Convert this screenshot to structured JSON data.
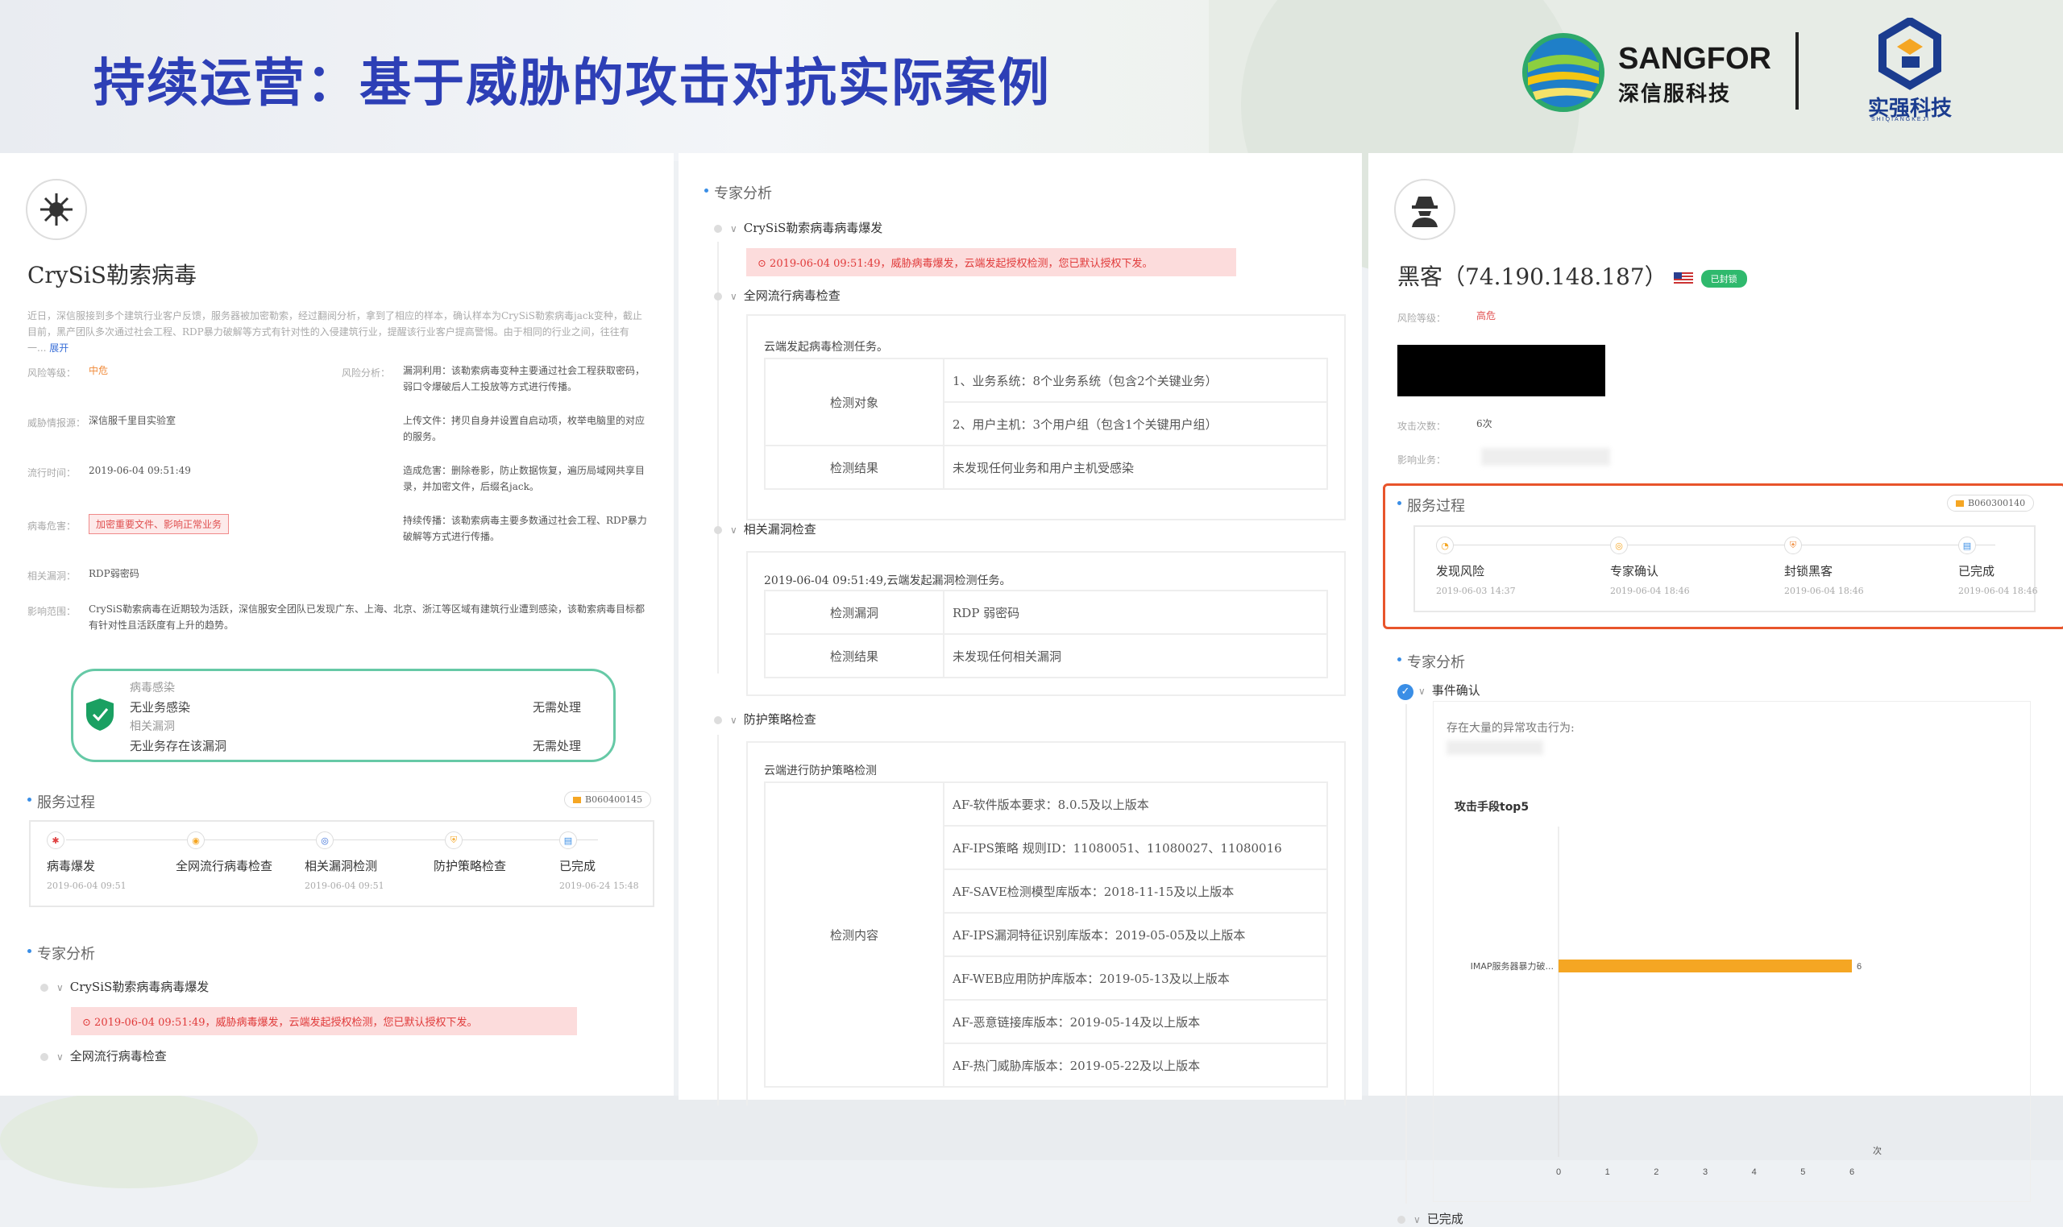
{
  "header": {
    "title": "持续运营：基于威胁的攻击对抗实际案例",
    "brand_en": "SANGFOR",
    "brand_cn": "深信服科技",
    "partner_name": "实强科技",
    "partner_sub": "SHIQIANGKEJI"
  },
  "panel1": {
    "name": "CrySiS勒索病毒",
    "description": "近日，深信服接到多个建筑行业客户反馈，服务器被加密勒索，经过翻阅分析，拿到了相应的样本，确认样本为CrySiS勒索病毒jack变种，截止目前，黑产团队多次通过社会工程、RDP暴力破解等方式有针对性的入侵建筑行业，提醒该行业客户提高警惕。由于相同的行业之间，往往有一...",
    "expand": "展开",
    "fields": [
      {
        "label": "风险等级：",
        "value": "中危"
      },
      {
        "label": "威胁情报源：",
        "value": "深信服千里目实验室"
      },
      {
        "label": "流行时间：",
        "value": "2019-06-04 09:51:49"
      },
      {
        "label": "病毒危害：",
        "value": "加密重要文件、影响正常业务"
      },
      {
        "label": "相关漏洞：",
        "value": "RDP弱密码"
      },
      {
        "label": "影响范围：",
        "value": "CrySiS勒索病毒在近期较为活跃，深信服安全团队已发现广东、上海、北京、浙江等区域有建筑行业遭到感染，该勒索病毒目标都有针对性且活跃度有上升的趋势。"
      }
    ],
    "risk_label": "风险分析：",
    "risk_items": [
      "漏洞利用：该勒索病毒变种主要通过社会工程获取密码，弱口令爆破后人工投放等方式进行传播。",
      "上传文件：拷贝自身并设置自启动项，枚举电脑里的对应的服务。",
      "造成危害：删除卷影，防止数据恢复，遍历局域网共享目录，并加密文件，后缀名jack。",
      "持续传播：该勒索病毒主要多数通过社会工程、RDP暴力破解等方式进行传播。"
    ],
    "status": [
      {
        "title": "病毒感染",
        "text": "无业务感染",
        "action": "无需处理"
      },
      {
        "title": "相关漏洞",
        "text": "无业务存在该漏洞",
        "action": "无需处理"
      }
    ],
    "process_title": "服务过程",
    "process_id": "B060400145",
    "steps": [
      {
        "label": "病毒爆发",
        "date": "2019-06-04 09:51"
      },
      {
        "label": "全网流行病毒检查",
        "date": ""
      },
      {
        "label": "相关漏洞检测",
        "date": "2019-06-04 09:51"
      },
      {
        "label": "防护策略检查",
        "date": ""
      },
      {
        "label": "已完成",
        "date": "2019-06-24 15:48"
      }
    ],
    "expert_title": "专家分析",
    "tree": [
      "CrySiS勒索病毒病毒爆发",
      "全网流行病毒检查"
    ],
    "alert": "2019-06-04 09:51:49，威胁病毒爆发，云端发起授权检测，您已默认授权下发。"
  },
  "panel2": {
    "expert_title": "专家分析",
    "node1": "CrySiS勒索病毒病毒爆发",
    "alert": "2019-06-04 09:51:49，威胁病毒爆发，云端发起授权检测，您已默认授权下发。",
    "node2": "全网流行病毒检查",
    "table1_caption": "云端发起病毒检测任务。",
    "table1": {
      "object_label": "检测对象",
      "objects": [
        "1、业务系统：8个业务系统（包含2个关键业务）",
        "2、用户主机：3个用户组（包含1个关键用户组）"
      ],
      "result_label": "检测结果",
      "result": "未发现任何业务和用户主机受感染"
    },
    "node3": "相关漏洞检查",
    "table2_caption": "2019-06-04 09:51:49,云端发起漏洞检测任务。",
    "table2": {
      "vuln_label": "检测漏洞",
      "vuln": "RDP 弱密码",
      "result_label": "检测结果",
      "result": "未发现任何相关漏洞"
    },
    "node4": "防护策略检查",
    "table3_caption": "云端进行防护策略检测",
    "table3": {
      "content_label": "检测内容",
      "items": [
        "AF-软件版本要求：8.0.5及以上版本",
        "AF-IPS策略 规则ID：11080051、11080027、11080016",
        "AF-SAVE检测模型库版本：2018-11-15及以上版本",
        "AF-IPS漏洞特征识别库版本：2019-05-05及以上版本",
        "AF-WEB应用防护库版本：2019-05-13及以上版本",
        "AF-恶意链接库版本：2019-05-14及以上版本",
        "AF-热门威胁库版本：2019-05-22及以上版本"
      ]
    }
  },
  "panel3": {
    "name": "黑客（74.190.148.187）",
    "badge": "已封锁",
    "risk_label": "风险等级：",
    "risk_value": "高危",
    "attack_count_label": "攻击次数：",
    "attack_count": "6次",
    "impact_label": "影响业务：",
    "process_title": "服务过程",
    "process_id": "B060300140",
    "steps": [
      {
        "label": "发现风险",
        "date": "2019-06-03 14:37"
      },
      {
        "label": "专家确认",
        "date": "2019-06-04 18:46"
      },
      {
        "label": "封锁黑客",
        "date": "2019-06-04 18:46"
      },
      {
        "label": "已完成",
        "date": "2019-06-04 18:46"
      }
    ],
    "expert_title": "专家分析",
    "event_confirm": "事件确认",
    "abnormal_text": "存在大量的异常攻击行为:",
    "done": "已完成"
  },
  "chart_data": {
    "type": "bar",
    "orientation": "horizontal",
    "title": "攻击手段top5",
    "categories": [
      "IMAP服务器暴力破..."
    ],
    "values": [
      6
    ],
    "data_labels": [
      "6"
    ],
    "xlim": [
      0,
      6
    ],
    "xticks": [
      "0",
      "1",
      "2",
      "3",
      "4",
      "5",
      "6"
    ],
    "xunit": "次",
    "bar_color": "#f5a623"
  },
  "colors": {
    "title": "#2d3fb6",
    "highlight": "#e8542b",
    "alert_bg": "#fcdcdc",
    "green": "#2fb96d"
  }
}
